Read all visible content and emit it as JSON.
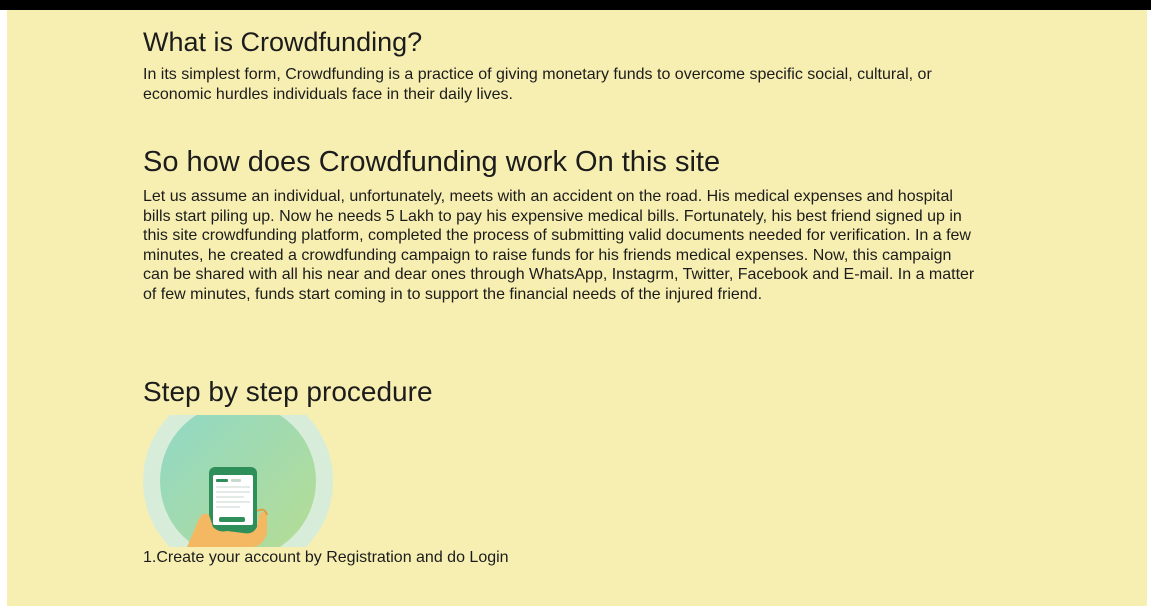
{
  "sections": {
    "what": {
      "heading": "What is Crowdfunding?",
      "text": "In its simplest form, Crowdfunding is a practice of giving monetary funds to overcome specific social, cultural, or economic hurdles individuals face in their daily lives."
    },
    "how": {
      "heading": "So how does Crowdfunding work On this site",
      "text": "Let us assume an individual, unfortunately, meets with an accident on the road. His medical expenses and hospital bills start piling up. Now he needs 5 Lakh to pay his expensive medical bills. Fortunately, his best friend signed up in this site crowdfunding platform, completed the process of submitting valid documents needed for verification. In a few minutes, he created a crowdfunding campaign to raise funds for his friends medical expenses. Now, this campaign can be shared with all his near and dear ones through WhatsApp, Instagrm, Twitter, Facebook and E-mail. In a matter of few minutes, funds start coming in to support the financial needs of the injured friend."
    },
    "steps": {
      "heading": "Step by step procedure",
      "items": [
        {
          "caption": "1.Create your account by Registration and do Login",
          "icon": "phone-in-hand-icon"
        }
      ]
    }
  },
  "colors": {
    "page_background": "#f7efb2",
    "top_bar": "#000000",
    "text": "#1c1c1c",
    "circle_outer": "#d8edd9",
    "circle_inner_start": "#8fd8c8",
    "circle_inner_end": "#b7dd92",
    "phone_green": "#2f8f5b",
    "hand": "#f4b862"
  }
}
